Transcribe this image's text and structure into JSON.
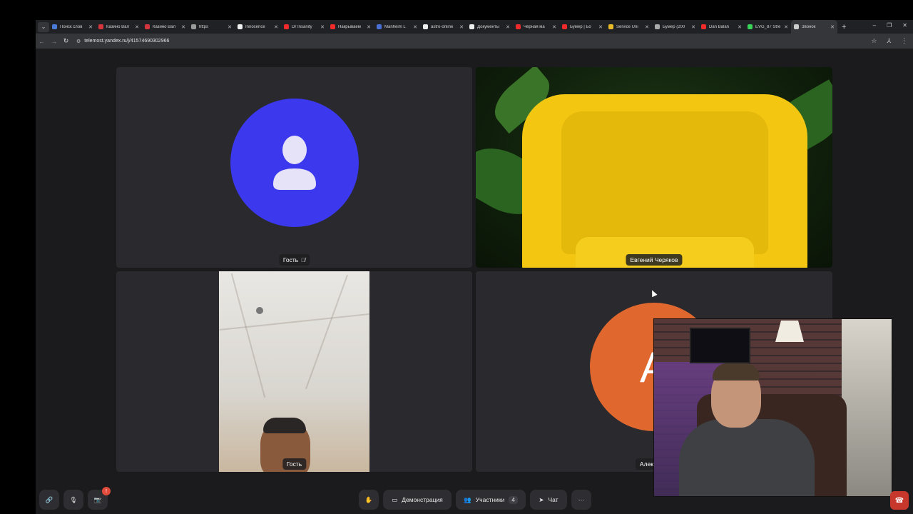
{
  "browser": {
    "tabs": [
      {
        "label": "Поиск слов",
        "fav_color": "#4a7bd4"
      },
      {
        "label": "Казино Вал",
        "fav_color": "#d4343b"
      },
      {
        "label": "Казино Вал",
        "fav_color": "#d4343b"
      },
      {
        "label": "https",
        "fav_color": "#9a9a9a"
      },
      {
        "label": "Innocence",
        "fav_color": "#f0f0f0"
      },
      {
        "label": "Dr Insanity",
        "fav_color": "#ee2a2a"
      },
      {
        "label": "Накрываем",
        "fav_color": "#ee2a2a"
      },
      {
        "label": "Manheim L",
        "fav_color": "#4a6fd4"
      },
      {
        "label": "astro-online",
        "fav_color": "#eeeeee"
      },
      {
        "label": "Документы",
        "fav_color": "#eeeeee"
      },
      {
        "label": "Чёрная ма",
        "fav_color": "#ee2a2a"
      },
      {
        "label": "Бумер | Бо",
        "fav_color": "#ee2a2a"
      },
      {
        "label": "Service Uni",
        "fav_color": "#e8b928"
      },
      {
        "label": "Бумер (200",
        "fav_color": "#aaaaaa"
      },
      {
        "label": "Dan Balan",
        "fav_color": "#ee2a2a"
      },
      {
        "label": "EVG_87 Stre",
        "fav_color": "#39d35a"
      },
      {
        "label": "Звонок",
        "fav_color": "#cccccc"
      }
    ],
    "url": "telemost.yandex.ru/j/41574690302966"
  },
  "tiles": {
    "guest1_name": "Гость",
    "speaker_name": "Евгений Черяков",
    "guest2_name": "Гость",
    "alex_initial": "А",
    "alex_name": "Алек"
  },
  "controls": {
    "notify_badge": "!",
    "screen_share_label": "Демонстрация",
    "participants_label": "Участники",
    "participants_count": "4",
    "chat_label": "Чат",
    "more_label": "···"
  },
  "colors": {
    "accent_blue": "#3b38ee",
    "avatar_orange": "#e0682f",
    "hangup_red": "#c8372b"
  }
}
